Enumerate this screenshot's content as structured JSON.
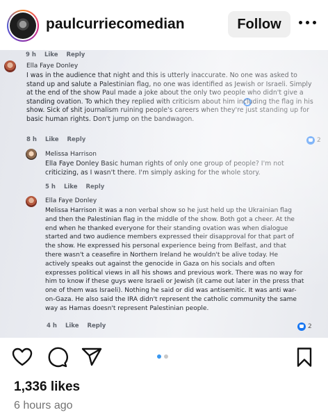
{
  "header": {
    "username": "paulcurriecomedian",
    "follow_label": "Follow",
    "more_icon": "more-horizontal-icon"
  },
  "photo": {
    "top_meta": {
      "time": "9 h",
      "like": "Like",
      "reply": "Reply"
    },
    "comments": [
      {
        "author": "Ella Faye Donley",
        "text": [
          "I was in the audience that night and this is utterly inaccurate. No one was asked to",
          "stand up and salute a Palestinian flag, no one was identified as Jewish or Israeli. Simply",
          "at the end of the show Paul made a joke about the only two people who didn't give a",
          "standing ovation. To which they replied with criticism about him including the flag in his",
          "show. Sick of shit journalism ruining people's careers when they're just standing up for",
          "basic human rights. Don't jump on the bandwagon."
        ],
        "meta": {
          "time": "8 h",
          "like": "Like",
          "reply": "Reply"
        },
        "reactions": "2"
      },
      {
        "author": "Melissa Harrison",
        "text": [
          "Ella Faye Donley Basic human rights of only one group of people? I'm not",
          "criticizing, as I wasn't there. I'm simply asking for the whole story."
        ],
        "meta": {
          "time": "5 h",
          "like": "Like",
          "reply": "Reply"
        }
      },
      {
        "author": "Ella Faye Donley",
        "text": [
          "Melissa Harrison it was a non verbal show so he just held up the Ukrainian flag",
          "and then the Palestinian flag in the middle of the show. Both got a cheer. At the",
          "end when he thanked everyone for their standing ovation was when dialogue",
          "started and two audience members expressed their disapproval for that part of",
          "the show. He expressed his personal experience being from Belfast, and that",
          "there wasn't a ceasefire in Northern Ireland he wouldn't be alive today. He",
          "actively speaks out against the genocide in Gaza on his socials and often",
          "expresses political views in all his shows and previous work. There was no way for",
          "him to know if these guys were Israeli or Jewish (it came out later in the press that",
          "one of them was Israeli). Nothing he said or did was antisemitic. It was anti war-",
          "on-Gaza. He also said the IRA didn't represent the catholic community the same",
          "way as Hamas doesn't represent Palestinian people."
        ],
        "meta": {
          "time": "4 h",
          "like": "Like",
          "reply": "Reply"
        },
        "reactions": "2"
      }
    ]
  },
  "actions": {
    "icons": [
      "heart-icon",
      "comment-icon",
      "share-icon",
      "bookmark-icon"
    ],
    "carousel_active": 0
  },
  "likes": "1,336 likes",
  "time": "6 hours ago"
}
